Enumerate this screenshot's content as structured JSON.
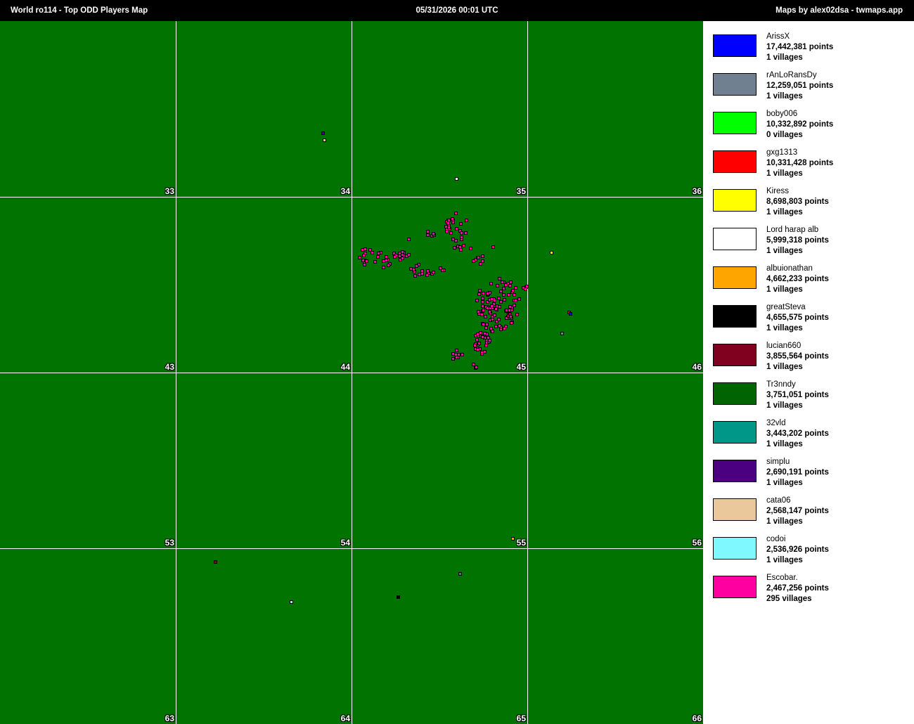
{
  "header": {
    "title": "World ro114  -  Top ODD Players Map",
    "timestamp": "05/31/2026 00:01 UTC",
    "credit": "Maps by alex02dsa - twmaps.app"
  },
  "map": {
    "background": "#007300",
    "grid_color": "#ffffff",
    "continents": [
      "33",
      "34",
      "35",
      "36",
      "43",
      "44",
      "45",
      "46",
      "53",
      "54",
      "55",
      "56",
      "63",
      "64",
      "65",
      "66"
    ]
  },
  "legend": [
    {
      "name": "ArissX",
      "points": "17,442,381 points",
      "villages": "1 villages",
      "color": "#0000ff"
    },
    {
      "name": "rAnLoRansDy",
      "points": "12,259,051 points",
      "villages": "1 villages",
      "color": "#708090"
    },
    {
      "name": "boby006",
      "points": "10,332,892 points",
      "villages": "0 villages",
      "color": "#00ff00"
    },
    {
      "name": "gxg1313",
      "points": "10,331,428 points",
      "villages": "1 villages",
      "color": "#ff0000"
    },
    {
      "name": "Kiress",
      "points": "8,698,803 points",
      "villages": "1 villages",
      "color": "#ffff00"
    },
    {
      "name": "Lord harap alb",
      "points": "5,999,318 points",
      "villages": "1 villages",
      "color": "#ffffff"
    },
    {
      "name": "albuionathan",
      "points": "4,662,233 points",
      "villages": "1 villages",
      "color": "#ffa500"
    },
    {
      "name": "greatSteva",
      "points": "4,655,575 points",
      "villages": "1 villages",
      "color": "#000000"
    },
    {
      "name": "lucian660",
      "points": "3,855,564 points",
      "villages": "1 villages",
      "color": "#800020"
    },
    {
      "name": "Tr3nndy",
      "points": "3,751,051 points",
      "villages": "1 villages",
      "color": "#006400"
    },
    {
      "name": "32vld",
      "points": "3,443,202 points",
      "villages": "1 villages",
      "color": "#009688"
    },
    {
      "name": "simplu",
      "points": "2,690,191 points",
      "villages": "1 villages",
      "color": "#4b0082"
    },
    {
      "name": "cata06",
      "points": "2,568,147 points",
      "villages": "1 villages",
      "color": "#ebc89b"
    },
    {
      "name": "codoi",
      "points": "2,536,926 points",
      "villages": "1 villages",
      "color": "#80f8ff"
    },
    {
      "name": "Escobar.",
      "points": "2,467,256 points",
      "villages": "295 villages",
      "color": "#ff00a0"
    }
  ]
}
